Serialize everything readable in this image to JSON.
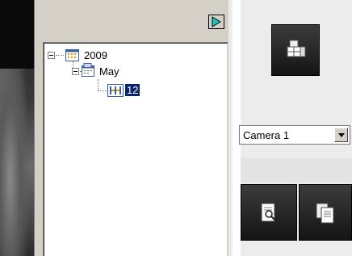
{
  "tree": {
    "year": "2009",
    "month": "May",
    "day": "12"
  },
  "camera_select": {
    "value": "Camera 1"
  },
  "icons": {
    "toggle": "play-arrow-icon",
    "layout": "layout-grid-icon",
    "search": "search-document-icon",
    "copy": "copy-document-icon"
  }
}
